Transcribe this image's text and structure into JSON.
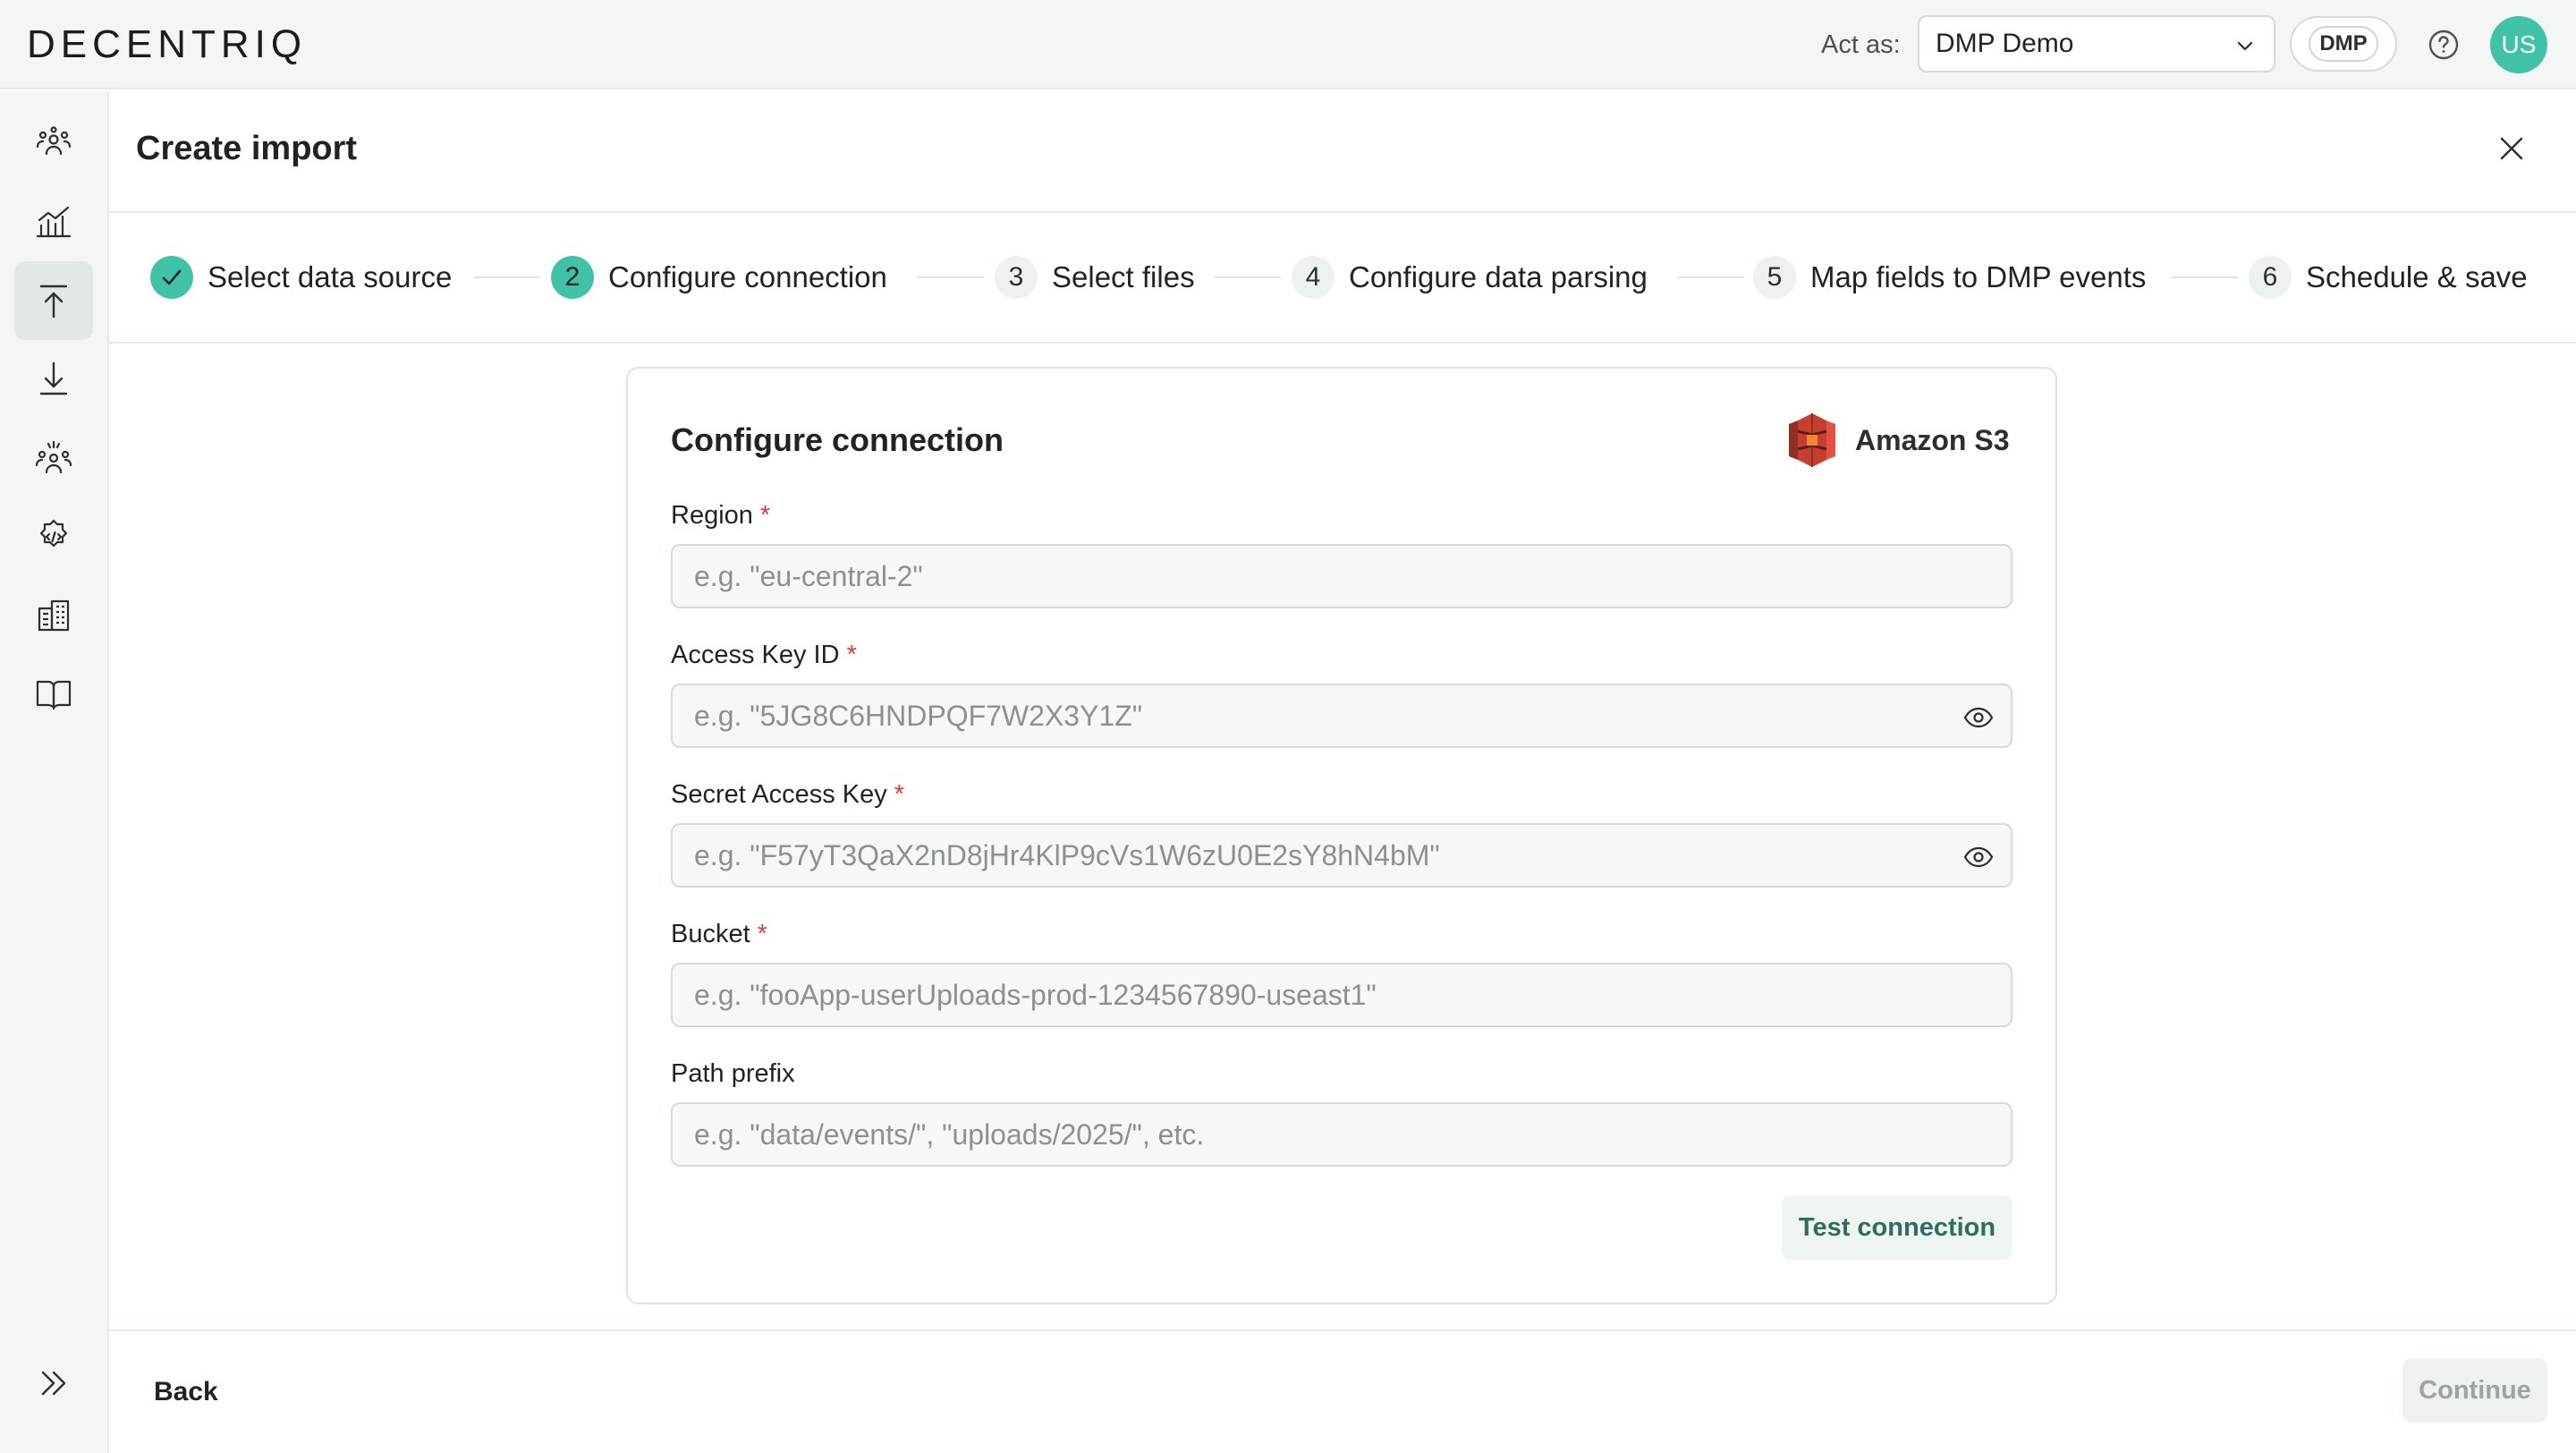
{
  "app": {
    "logo_text": "DECENTRIQ"
  },
  "topbar": {
    "act_as_label": "Act as:",
    "act_as_value": "DMP Demo",
    "org_chip": "DMP",
    "avatar_initials": "US",
    "accent_color": "#3fc2a5"
  },
  "sidebar": {
    "items": [
      {
        "icon": "audiences-icon",
        "active": false
      },
      {
        "icon": "insights-chart-icon",
        "active": false
      },
      {
        "icon": "upload-import-icon",
        "active": true
      },
      {
        "icon": "download-export-icon",
        "active": false
      },
      {
        "icon": "people-group-icon",
        "active": false
      },
      {
        "icon": "settings-code-icon",
        "active": false
      },
      {
        "icon": "buildings-icon",
        "active": false
      },
      {
        "icon": "book-icon",
        "active": false
      }
    ],
    "expand_icon": "chevrons-right-icon"
  },
  "header": {
    "title": "Create import"
  },
  "stepper": {
    "steps": [
      {
        "number": "1",
        "label": "Select data source",
        "state": "done"
      },
      {
        "number": "2",
        "label": "Configure connection",
        "state": "current"
      },
      {
        "number": "3",
        "label": "Select files",
        "state": "upcoming"
      },
      {
        "number": "4",
        "label": "Configure data parsing",
        "state": "upcoming"
      },
      {
        "number": "5",
        "label": "Map fields to DMP events",
        "state": "upcoming"
      },
      {
        "number": "6",
        "label": "Schedule & save",
        "state": "upcoming"
      }
    ]
  },
  "form": {
    "title": "Configure connection",
    "provider": "Amazon S3",
    "fields": [
      {
        "label": "Region",
        "required": "*",
        "value": "",
        "placeholder": "e.g. \"eu-central-2\""
      },
      {
        "label": "Access Key ID",
        "required": "*",
        "value": "",
        "placeholder": "e.g. \"5JG8C6HNDPQF7W2X3Y1Z\""
      },
      {
        "label": "Secret Access Key",
        "required": "*",
        "value": "",
        "placeholder": "e.g. \"F57yT3QaX2nD8jHr4KlP9cVs1W6zU0E2sY8hN4bM\""
      },
      {
        "label": "Bucket",
        "required": "*",
        "value": "",
        "placeholder": "e.g. \"fooApp-userUploads-prod-1234567890-useast1\""
      },
      {
        "label": "Path prefix",
        "required": "",
        "value": "",
        "placeholder": "e.g. \"data/events/\", \"uploads/2025/\", etc."
      }
    ],
    "test_button": "Test connection"
  },
  "footer": {
    "back": "Back",
    "continue": "Continue"
  }
}
